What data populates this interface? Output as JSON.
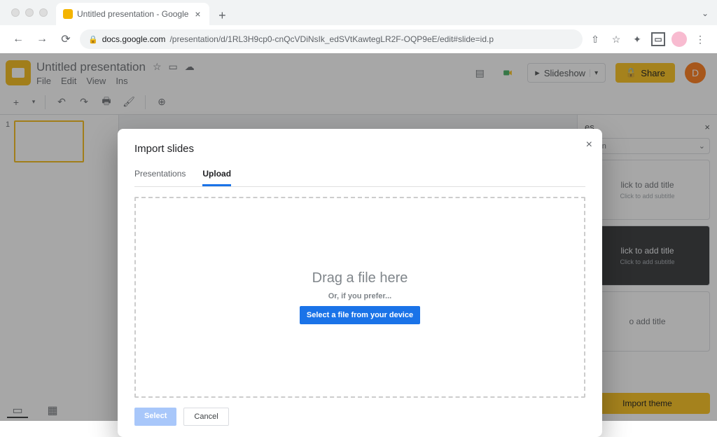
{
  "browser": {
    "tab_title": "Untitled presentation - Google",
    "url_host": "docs.google.com",
    "url_path": "/presentation/d/1RL3H9cp0-cnQcVDiNsIk_edSVtKawtegLR2F-OQP9eE/edit#slide=id.p"
  },
  "app": {
    "doc_title": "Untitled presentation",
    "menu": [
      "File",
      "Edit",
      "View",
      "Ins"
    ],
    "slideshow_label": "Slideshow",
    "share_label": "Share",
    "avatar_letter": "D"
  },
  "themes": {
    "panel_title": "es",
    "select_label": "ation",
    "card1_title": "lick to add title",
    "card1_sub": "Click to add subtitle",
    "card2_title": "lick to add title",
    "card2_sub": "Click to add subtitle",
    "card3_title": "o add title",
    "import_btn": "Import theme"
  },
  "filmstrip": {
    "slide_number": "1"
  },
  "modal": {
    "title": "Import slides",
    "tabs": {
      "presentations": "Presentations",
      "upload": "Upload"
    },
    "drop_title": "Drag a file here",
    "drop_sub": "Or, if you prefer...",
    "select_file": "Select a file from your device",
    "select_btn": "Select",
    "cancel_btn": "Cancel"
  }
}
